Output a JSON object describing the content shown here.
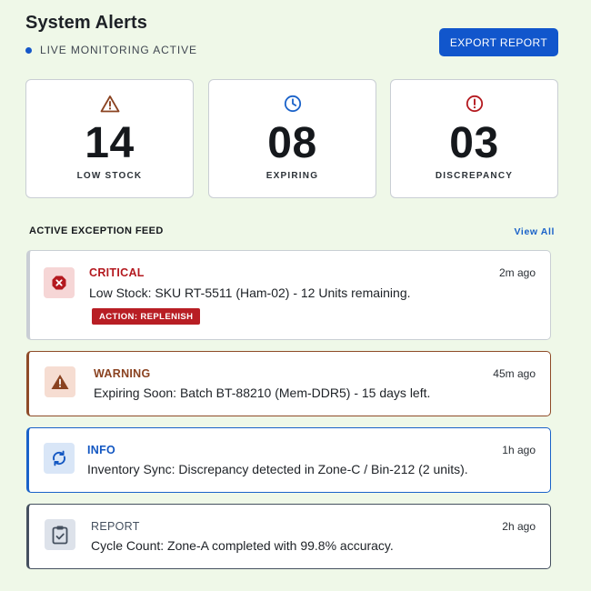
{
  "header": {
    "title": "System Alerts",
    "status": "LIVE MONITORING ACTIVE",
    "export_label": "EXPORT REPORT"
  },
  "stats": [
    {
      "icon": "warning-triangle-icon",
      "value": "14",
      "label": "LOW STOCK",
      "color": "#8a4220"
    },
    {
      "icon": "clock-icon",
      "value": "08",
      "label": "EXPIRING",
      "color": "#1a62c9"
    },
    {
      "icon": "alert-circle-icon",
      "value": "03",
      "label": "DISCREPANCY",
      "color": "#b4191f"
    }
  ],
  "feed": {
    "title": "ACTIVE EXCEPTION FEED",
    "view_all": "View All",
    "items": [
      {
        "level": "CRITICAL",
        "icon": "error-x-icon",
        "time": "2m ago",
        "message": "Low Stock: SKU RT-5511 (Ham-02) - 12 Units remaining.",
        "action": "ACTION: REPLENISH"
      },
      {
        "level": "WARNING",
        "icon": "warning-triangle-icon",
        "time": "45m ago",
        "message": "Expiring Soon: Batch BT-88210 (Mem-DDR5) - 15 days left."
      },
      {
        "level": "INFO",
        "icon": "sync-icon",
        "time": "1h ago",
        "message": "Inventory Sync: Discrepancy detected in Zone-C / Bin-212 (2 units)."
      },
      {
        "level": "REPORT",
        "icon": "clipboard-check-icon",
        "time": "2h ago",
        "message": "Cycle Count: Zone-A completed with 99.8% accuracy."
      }
    ]
  },
  "colors": {
    "background": "#eff8e8",
    "primary": "#1156cc",
    "critical": "#b4191f",
    "warning": "#8a4220",
    "info": "#1a62c9",
    "report": "#45505f"
  }
}
